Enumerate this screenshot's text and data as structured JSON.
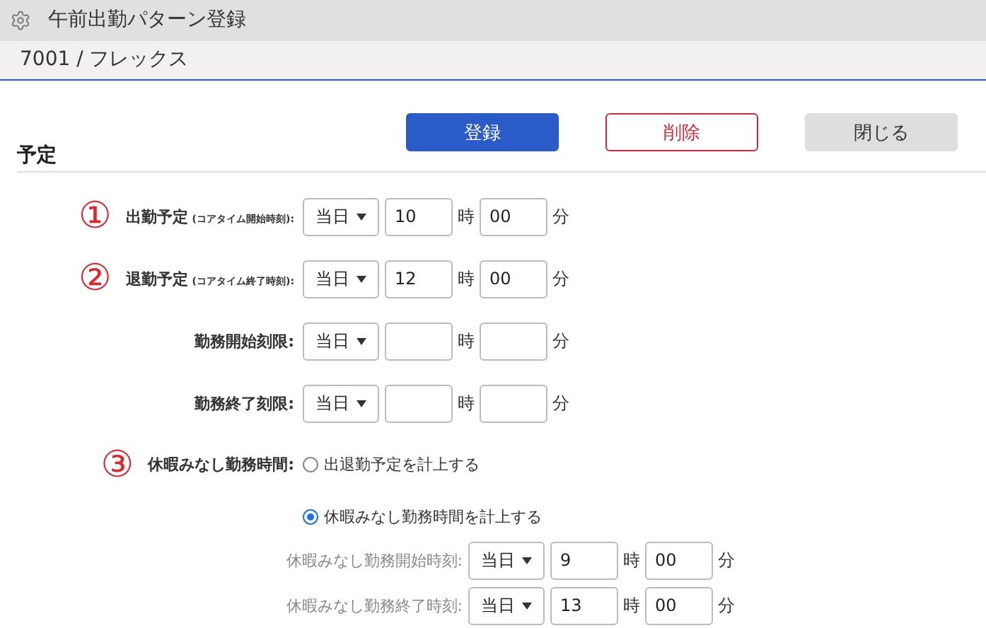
{
  "window": {
    "title": "午前出勤パターン登録"
  },
  "header": {
    "text": "7001 / フレックス"
  },
  "buttons": [
    {
      "label": "登録",
      "kind": "primary"
    },
    {
      "label": "削除",
      "kind": "danger"
    },
    {
      "label": "閉じる",
      "kind": "secondary"
    }
  ],
  "section": {
    "title": "予定"
  },
  "time_rows": [
    {
      "marker": "①",
      "label": "出勤予定",
      "note": "(コアタイム開始時刻):",
      "day": "当日",
      "hour": "10",
      "hour_unit": "時",
      "minute": "00",
      "minute_unit": "分"
    },
    {
      "marker": "②",
      "label": "退勤予定",
      "note": "(コアタイム終了時刻):",
      "day": "当日",
      "hour": "12",
      "hour_unit": "時",
      "minute": "00",
      "minute_unit": "分"
    },
    {
      "label": "勤務開始刻限:",
      "day": "当日",
      "hour_unit": "時",
      "minute_unit": "分"
    },
    {
      "label": "勤務終了刻限:",
      "day": "当日",
      "hour_unit": "時",
      "minute_unit": "分"
    }
  ],
  "leave": {
    "marker": "③",
    "label": "休暇みなし勤務時間:",
    "options": [
      {
        "label": "出退勤予定を計上する",
        "selected": false
      },
      {
        "label": "休暇みなし勤務時間を計上する",
        "selected": true
      }
    ],
    "sub_rows": [
      {
        "label": "休暇みなし勤務開始時刻:",
        "day": "当日",
        "hour": "9",
        "hour_unit": "時",
        "minute": "00",
        "minute_unit": "分"
      },
      {
        "label": "休暇みなし勤務終了時刻:",
        "day": "当日",
        "hour": "13",
        "hour_unit": "時",
        "minute": "00",
        "minute_unit": "分"
      }
    ]
  }
}
